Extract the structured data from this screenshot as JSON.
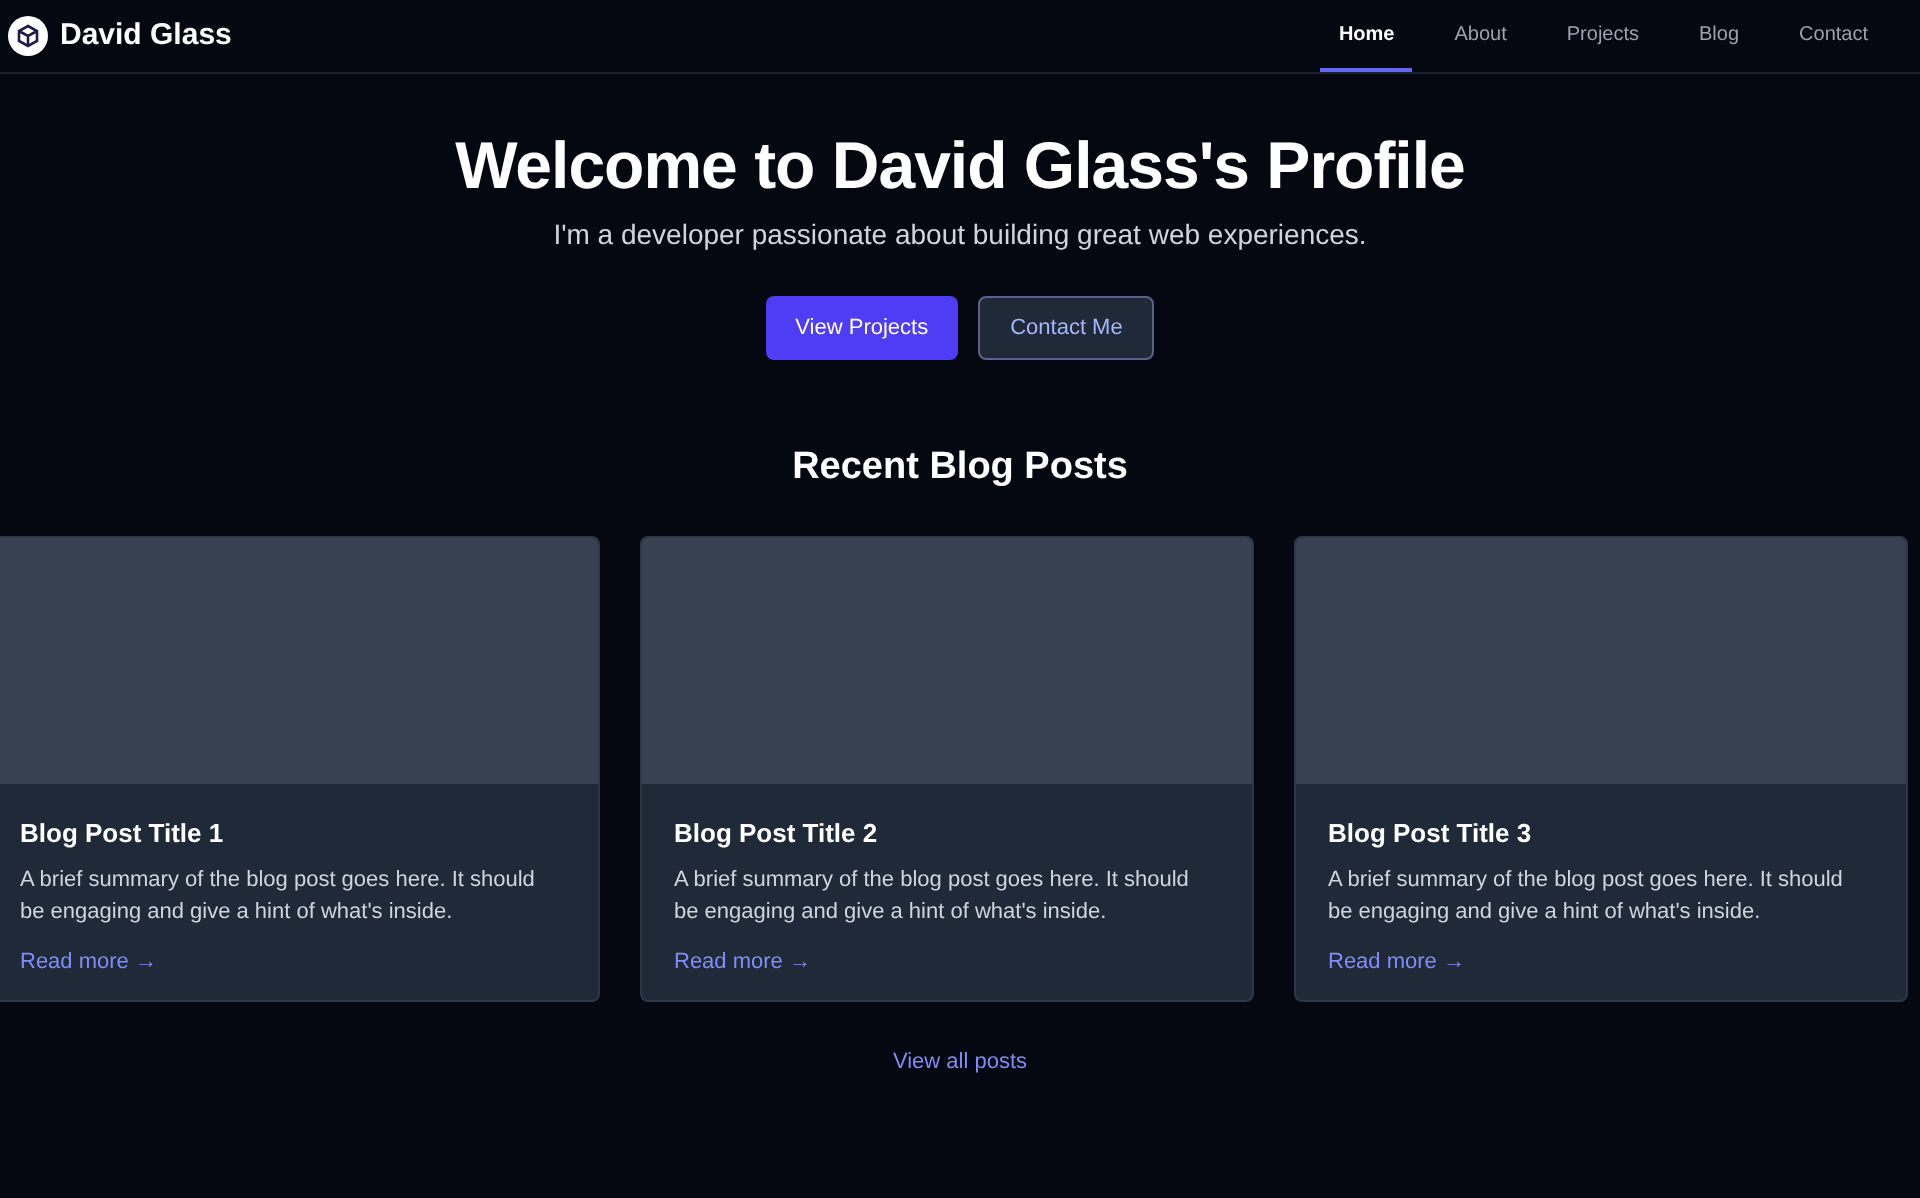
{
  "brand": {
    "name": "David Glass"
  },
  "nav": [
    {
      "label": "Home",
      "selected": true
    },
    {
      "label": "About",
      "selected": false
    },
    {
      "label": "Projects",
      "selected": false
    },
    {
      "label": "Blog",
      "selected": false
    },
    {
      "label": "Contact",
      "selected": false
    }
  ],
  "hero": {
    "title": "Welcome to David Glass's Profile",
    "subtitle": "I'm a developer passionate about building great web experiences.",
    "buttons": [
      {
        "label": "View Projects",
        "kind": "primary"
      },
      {
        "label": "Contact Me",
        "kind": "outline"
      }
    ]
  },
  "blog": {
    "heading": "Recent Blog Posts",
    "posts": [
      {
        "title": "Blog Post Title 1",
        "summary": "A brief summary of the blog post goes here. It should be engaging and give a hint of what's inside.",
        "link": "Read more →"
      },
      {
        "title": "Blog Post Title 2",
        "summary": "A brief summary of the blog post goes here. It should be engaging and give a hint of what's inside.",
        "link": "Read more →"
      },
      {
        "title": "Blog Post Title 3",
        "summary": "A brief summary of the blog post goes here. It should be engaging and give a hint of what's inside.",
        "link": "Read more →"
      }
    ],
    "view_all": "View all posts"
  }
}
